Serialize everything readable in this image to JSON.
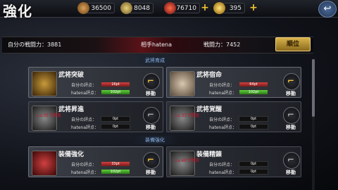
{
  "header": {
    "title": "強化",
    "resources": [
      {
        "name": "chest-icon",
        "value": "36500",
        "color": "#b07a3a"
      },
      {
        "name": "coin-icon",
        "value": "8048",
        "color": "#c9a64a"
      },
      {
        "name": "orb-icon",
        "value": "76710",
        "color": "#c0392b"
      },
      {
        "name": "gem-icon",
        "value": "395",
        "color": "#e0b020"
      }
    ]
  },
  "power": {
    "self_label": "自分の戦闘力：3881",
    "opponent_label": "相手hatena",
    "opponent_power": "戦闘力：7452",
    "rank_button": "順位"
  },
  "sections": {
    "general": "武将育成",
    "equipment": "装備強化"
  },
  "cards": [
    {
      "name": "武将突破",
      "self_label": "自分の評点：",
      "self_value": "16pt",
      "other_label": "hatena評点：",
      "other_value": "102pt",
      "move": "移動",
      "locked": ""
    },
    {
      "name": "武将宿命",
      "self_label": "自分の評点：",
      "self_value": "64pt",
      "other_label": "hatena評点：",
      "other_value": "102pt",
      "move": "移動",
      "locked": ""
    },
    {
      "name": "武将昇進",
      "self_label": "自分の評点：",
      "self_value": "0pt",
      "other_label": "hatena評点：",
      "other_value": "0pt",
      "move": "移動",
      "locked": "Lv.35で開放"
    },
    {
      "name": "武将覚醒",
      "self_label": "自分の評点：",
      "self_value": "0pt",
      "other_label": "hatena評点：",
      "other_value": "0pt",
      "move": "移動",
      "locked": "Lv.33で開放"
    },
    {
      "name": "装備強化",
      "self_label": "自分の評点：",
      "self_value": "33pt",
      "other_label": "hatena評点：",
      "other_value": "102pt",
      "move": "移動",
      "locked": ""
    },
    {
      "name": "装備精錬",
      "self_label": "自分の評点：",
      "self_value": "0pt",
      "other_label": "hatena評点：",
      "other_value": "0pt",
      "move": "移動",
      "locked": "Lv.48で開放"
    }
  ]
}
